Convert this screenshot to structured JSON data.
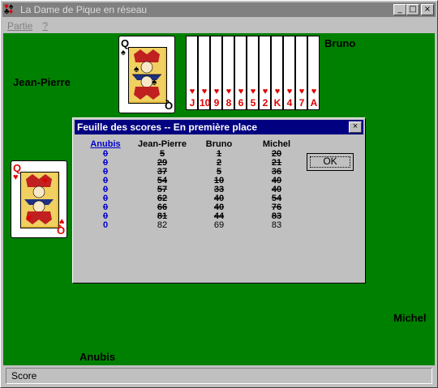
{
  "window": {
    "title": "La Dame de Pique en réseau",
    "buttons": [
      "_",
      "□",
      "×"
    ]
  },
  "menu": {
    "items": [
      "Partie",
      "?"
    ]
  },
  "players": {
    "north": "Bruno",
    "west": "Jean-Pierre",
    "east": "Michel",
    "south": "Anubis"
  },
  "north_hand": {
    "top_card": {
      "rank": "Q",
      "suit": "♠",
      "color": "#000000"
    },
    "cards": [
      {
        "rank": "Q",
        "suit": "♠"
      },
      {
        "rank": "J",
        "suit": "♥"
      },
      {
        "rank": "10",
        "suit": "♥"
      },
      {
        "rank": "9",
        "suit": "♥"
      },
      {
        "rank": "8",
        "suit": "♥"
      },
      {
        "rank": "6",
        "suit": "♥"
      },
      {
        "rank": "5",
        "suit": "♥"
      },
      {
        "rank": "2",
        "suit": "♥"
      },
      {
        "rank": "K",
        "suit": "♥"
      },
      {
        "rank": "4",
        "suit": "♥"
      },
      {
        "rank": "7",
        "suit": "♥"
      },
      {
        "rank": "A",
        "suit": "♥"
      }
    ]
  },
  "west_card": {
    "rank": "Q",
    "suit": "♥",
    "color": "#e00000"
  },
  "dialog": {
    "title": "Feuille des scores -- En première place",
    "close": "×",
    "ok": "OK",
    "columns": [
      {
        "name": "Anubis",
        "scores": [
          "0",
          "0",
          "0",
          "0",
          "0",
          "0",
          "0",
          "0",
          "0",
          "0"
        ]
      },
      {
        "name": "Jean-Pierre",
        "scores": [
          "5",
          "29",
          "37",
          "54",
          "57",
          "62",
          "66",
          "81",
          "82"
        ]
      },
      {
        "name": "Bruno",
        "scores": [
          "1",
          "2",
          "5",
          "10",
          "33",
          "40",
          "40",
          "44",
          "69"
        ]
      },
      {
        "name": "Michel",
        "scores": [
          "20",
          "21",
          "36",
          "40",
          "40",
          "54",
          "76",
          "83",
          "83"
        ]
      }
    ]
  },
  "status": {
    "text": "Score"
  },
  "colors": {
    "table": "#008000",
    "dialog_title": "#000080",
    "hearts": "#e00000",
    "first_place": "#0000cc"
  }
}
